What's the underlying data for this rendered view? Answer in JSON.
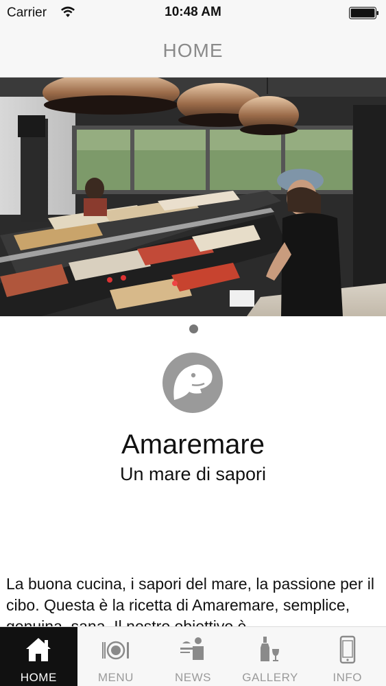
{
  "status_bar": {
    "carrier": "Carrier",
    "time": "10:48 AM",
    "wifi_icon": "wifi-icon",
    "battery_icon": "battery-icon"
  },
  "nav": {
    "title": "HOME"
  },
  "carousel": {
    "page_count": 1,
    "current_page": 1
  },
  "brand": {
    "logo_icon": "fish-head-logo-icon",
    "name": "Amaremare",
    "tagline": "Un mare di sapori"
  },
  "intro": {
    "text": "La buona cucina, i sapori del mare, la passione per il cibo. Questa è la ricetta di Amaremare, semplice, genuina, sana. Il nostro obiettivo è"
  },
  "tabs": [
    {
      "label": "HOME",
      "icon": "house-icon",
      "active": true
    },
    {
      "label": "MENU",
      "icon": "plate-cutlery-icon",
      "active": false
    },
    {
      "label": "NEWS",
      "icon": "waiter-icon",
      "active": false
    },
    {
      "label": "GALLERY",
      "icon": "wine-bottle-icon",
      "active": false
    },
    {
      "label": "INFO",
      "icon": "smartphone-icon",
      "active": false
    }
  ],
  "colors": {
    "tab_active_bg": "#111111",
    "tab_inactive_label": "#9a9a9a",
    "nav_title": "#8a8a8a",
    "logo_grey": "#9a9a9a"
  }
}
